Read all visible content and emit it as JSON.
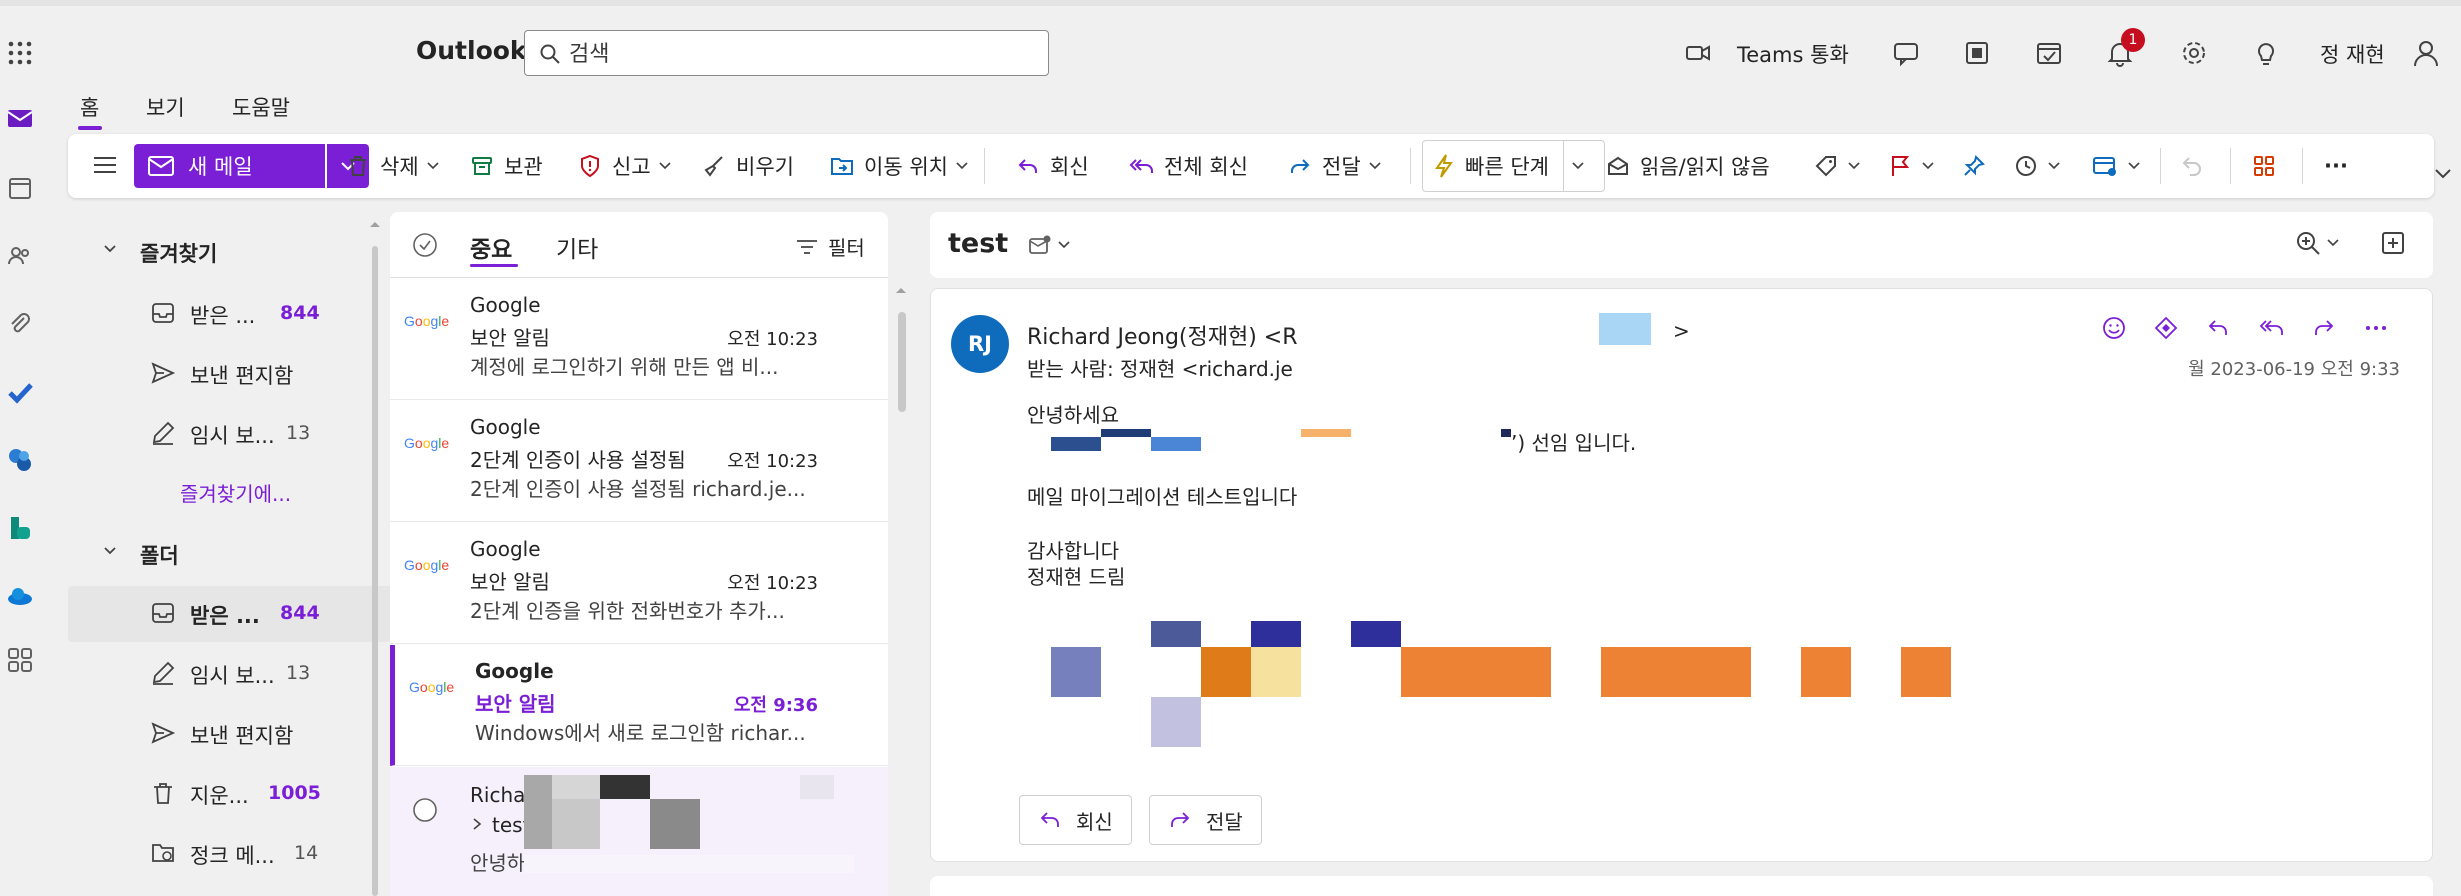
{
  "topbar": {
    "app_name": "Outlook",
    "search_placeholder": "검색",
    "teams_call_label": "Teams 통화",
    "notification_count": "1",
    "user_name": "정 재현",
    "icons": [
      "waffle-icon",
      "search-icon",
      "video-icon",
      "chat-icon",
      "office-icon",
      "calendar-check-icon",
      "bell-icon",
      "gear-icon",
      "lightbulb-icon",
      "person-icon"
    ]
  },
  "nav_tabs": [
    "홈",
    "보기",
    "도움말"
  ],
  "ribbon": {
    "new_mail": "새 메일",
    "delete": "삭제",
    "archive": "보관",
    "report": "신고",
    "sweep": "비우기",
    "move_to": "이동 위치",
    "reply": "회신",
    "reply_all": "전체 회신",
    "forward": "전달",
    "quick_steps": "빠른 단계",
    "read_unread": "읽음/읽지 않음",
    "more": "···"
  },
  "folders": {
    "favorites_header": "즐겨찾기",
    "favorites": [
      {
        "label": "받은 ...",
        "count": "844",
        "bold": true,
        "icon": "inbox-icon"
      },
      {
        "label": "보낸 편지함",
        "count": "",
        "bold": false,
        "icon": "send-icon"
      },
      {
        "label": "임시 보...",
        "count": "13",
        "bold": false,
        "icon": "draft-icon"
      }
    ],
    "favorites_more": "즐겨찾기에...",
    "folders_header": "폴더",
    "folders": [
      {
        "label": "받은 ...",
        "count": "844",
        "bold": true,
        "icon": "inbox-icon"
      },
      {
        "label": "임시 보...",
        "count": "13",
        "bold": false,
        "icon": "draft-icon"
      },
      {
        "label": "보낸 편지함",
        "count": "",
        "bold": false,
        "icon": "send-icon"
      },
      {
        "label": "지운...",
        "count": "1005",
        "bold": true,
        "icon": "trash-icon"
      },
      {
        "label": "정크 메...",
        "count": "14",
        "bold": false,
        "icon": "junk-icon"
      }
    ]
  },
  "message_list": {
    "tab_focused": "중요",
    "tab_other": "기타",
    "filter_label": "필터",
    "messages": [
      {
        "logo": "Google",
        "from": "Google",
        "subject": "보안 알림",
        "time": "오전 10:23",
        "preview": "계정에 로그인하기 위해 만든 앱 비...",
        "unread": false
      },
      {
        "logo": "Google",
        "from": "Google",
        "subject": "2단계 인증이 사용 설정됨",
        "time": "오전 10:23",
        "preview": "2단계 인증이 사용 설정됨 richard.je...",
        "unread": false
      },
      {
        "logo": "Google",
        "from": "Google",
        "subject": "보안 알림",
        "time": "오전 10:23",
        "preview": "2단계 인증을 위한 전화번호가 추가...",
        "unread": false
      },
      {
        "logo": "Google",
        "from": "Google",
        "subject": "보안 알림",
        "time": "오전 9:36",
        "preview": "Windows에서 새로 로그인함 richar...",
        "unread": true
      },
      {
        "logo": "",
        "from": "Richar",
        "subject": "test",
        "time": "",
        "preview": "안녕하",
        "unread": false
      }
    ]
  },
  "reading_pane": {
    "subject": "test",
    "avatar_initials": "RJ",
    "sender": "Richard Jeong(정재현) <R",
    "sender_tail": ">",
    "to": "받는 사람:  정재현 <richard.je",
    "date": "월 2023-06-19 오전 9:33",
    "body": {
      "greeting": "안녕하세요",
      "intro_tail": "’) 선임 입니다.",
      "line2": "메일 마이그레이션 테스트입니다",
      "thanks": "감사합니다",
      "signoff": "정재현 드림"
    },
    "reply_button": "회신",
    "forward_button": "전달"
  },
  "colors": {
    "accent": "#7b1fd6",
    "avatar": "#0f6cbd",
    "background": "#f0f0f0"
  }
}
